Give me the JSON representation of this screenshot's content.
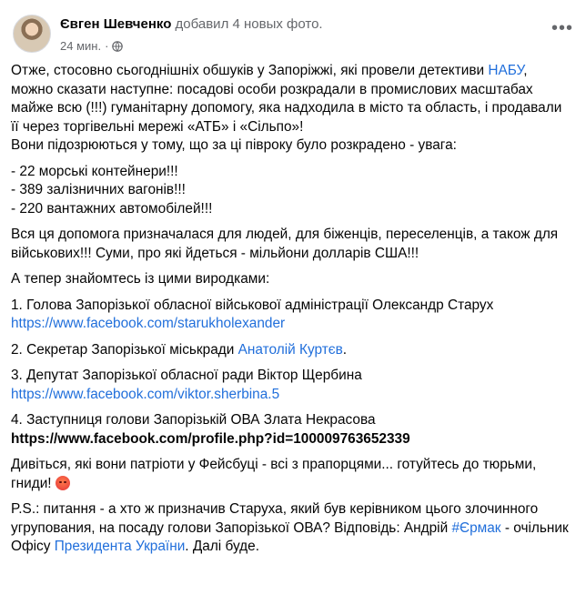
{
  "post": {
    "author": "Євген Шевченко",
    "action": "добавил 4 новых фото.",
    "time": "24 мин.",
    "body": {
      "p1_a": "Отже, стосовно сьогоднішніх обшуків у Запоріжжі, які провели детективи ",
      "p1_link": "НАБУ",
      "p1_b": ", можно сказати наступне: посадові особи розкрадали в промислових масштабах майже всю (!!!) гуманітарну допомогу, яка надходила в місто та область, і продавали її через торгівельні мережі «АТБ» і «Сільпо»!",
      "p1_c": "Вони підозрюються у тому, що за ці півроку було розкрадено - увага:",
      "list": [
        "- 22 морські контейнери!!!",
        "- 389 залізничних вагонів!!!",
        "- 220 вантажних автомобілей!!!"
      ],
      "p3": "Вся ця допомога призначалася для людей, для біженців, переселенців, а також для військових!!! Суми, про які йдеться - мільйони долларів США!!!",
      "p4": "А тепер знайомтесь із цими виродками:",
      "item1_text": "1. Голова Запорізької обласної військової адміністрації Олександр Старух",
      "item1_link": "https://www.facebook.com/starukholexander",
      "item2_text": "2. Секретар Запорізької міськради ",
      "item2_link": "Анатолій Куртєв",
      "item2_end": ".",
      "item3_text": "3. Депутат Запорізької обласної ради Віктор Щербина",
      "item3_link": "https://www.facebook.com/viktor.sherbina.5",
      "item4_text": "4. Заступниця голови Запорізькій ОВА Злата Некрасова",
      "item4_url": "https://www.facebook.com/profile.php?id=100009763652339",
      "p9": "Дивіться, які вони патріоти у Фейсбуці - всі з прапорцями... готуйтесь до тюрьми, гниди! ",
      "ps_a": "P.S.: питання - а хто ж призначив Старуха, який був керівником цього злочинного угрупования, на посаду голови Запорізької ОВА? Відповідь: Андрій ",
      "ps_link1": "#Єрмак",
      "ps_b": " - очільник Офісу ",
      "ps_link2": "Президента України",
      "ps_c": ". Далі буде."
    }
  },
  "colors": {
    "link": "#216fdb",
    "secondary": "#65676b"
  },
  "icons": [
    "avatar",
    "globe-icon",
    "more-icon",
    "angry-face-icon"
  ]
}
